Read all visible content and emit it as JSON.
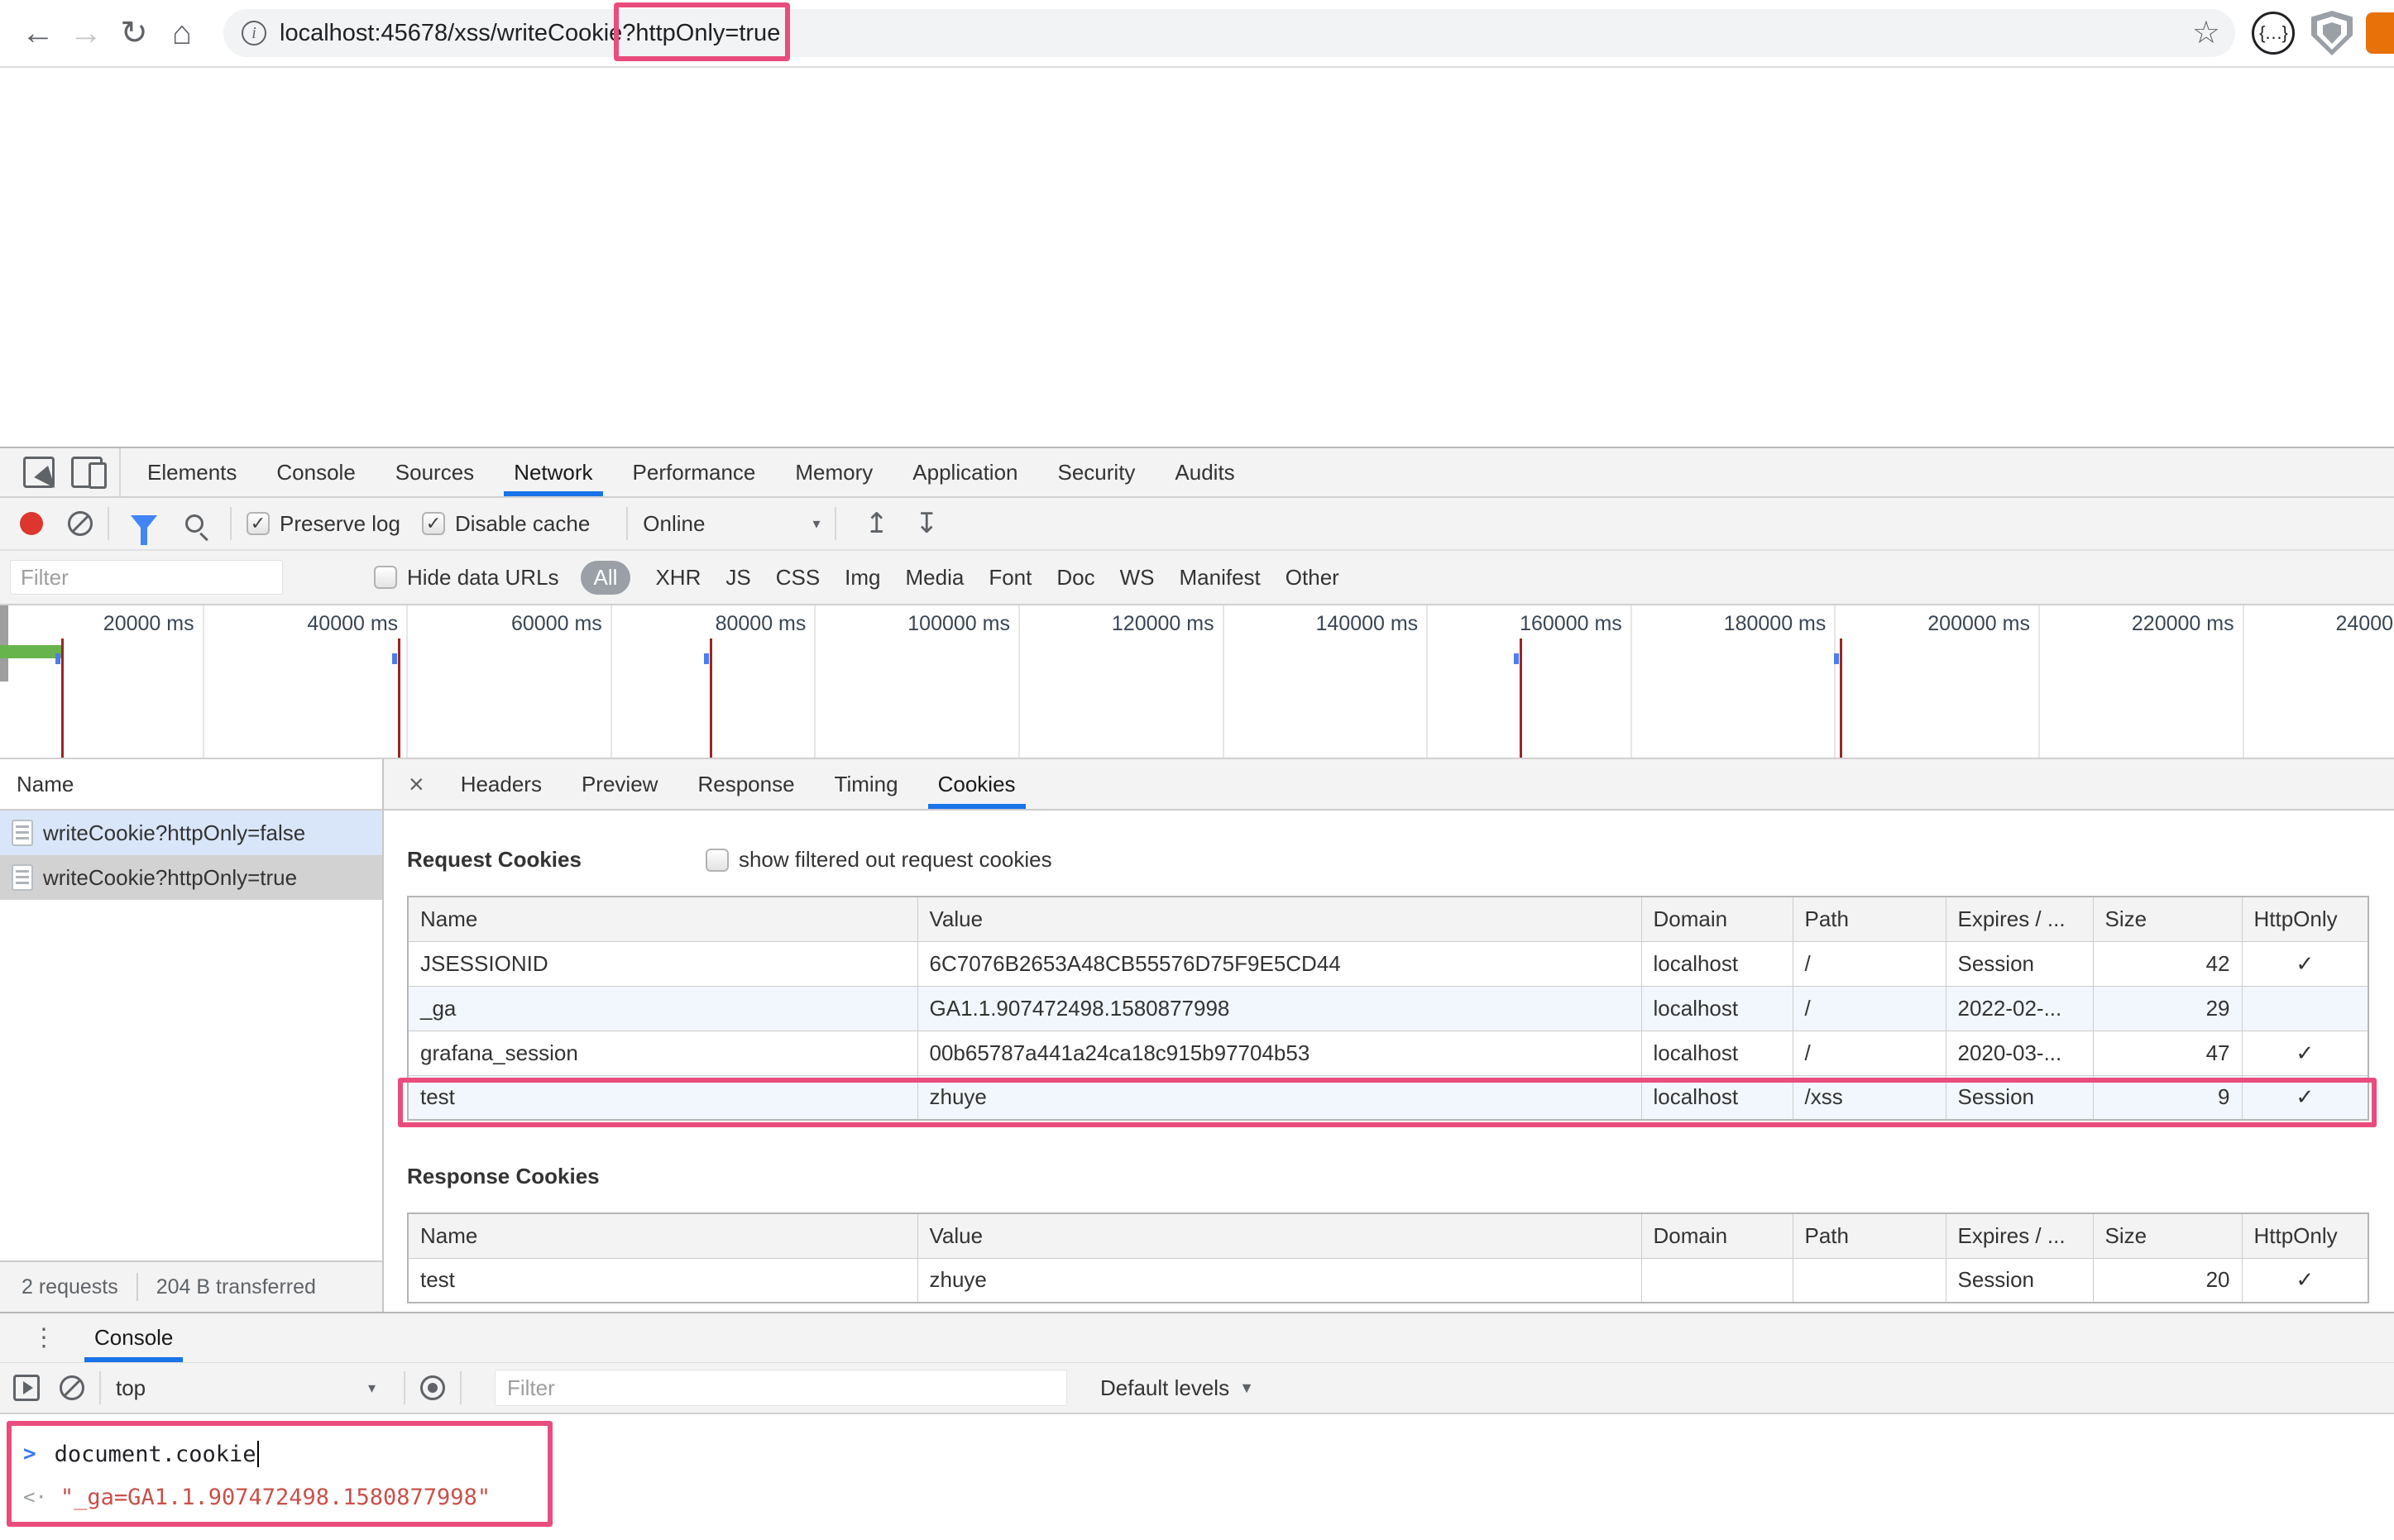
{
  "browser": {
    "url_prefix": "localhost:45678/xss/writeCookie",
    "url_highlight": "?httpOnly=true",
    "icons": {
      "back": "arrow-left",
      "forward": "arrow-right",
      "reload": "refresh",
      "home": "home",
      "page_info": "info-circle",
      "bookmark": "star-outline",
      "extension_braces": "curly-braces-circle",
      "extension_shield": "shield",
      "extension_partial": "orange-square"
    }
  },
  "devtools": {
    "main_tabs": [
      "Elements",
      "Console",
      "Sources",
      "Network",
      "Performance",
      "Memory",
      "Application",
      "Security",
      "Audits"
    ],
    "active_main_tab": "Network",
    "network_toolbar": {
      "preserve_log_label": "Preserve log",
      "preserve_log_checked": true,
      "disable_cache_label": "Disable cache",
      "disable_cache_checked": true,
      "throttling": "Online"
    },
    "filter_bar": {
      "placeholder": "Filter",
      "hide_data_urls_label": "Hide data URLs",
      "hide_data_urls_checked": false,
      "types": [
        "All",
        "XHR",
        "JS",
        "CSS",
        "Img",
        "Media",
        "Font",
        "Doc",
        "WS",
        "Manifest",
        "Other"
      ],
      "active_type": "All"
    },
    "timeline": {
      "tick_interval_ms": 20000,
      "tick_labels": [
        "20000 ms",
        "40000 ms",
        "60000 ms",
        "80000 ms",
        "100000 ms",
        "120000 ms",
        "140000 ms",
        "160000 ms",
        "180000 ms",
        "200000 ms",
        "220000 ms",
        "240000 ms"
      ],
      "load_events_ms": [
        6000,
        39000,
        69600,
        149000,
        180400
      ],
      "first_request_bar_ms": {
        "start": 0,
        "end": 6200
      }
    },
    "request_list": {
      "header": "Name",
      "rows": [
        {
          "name": "writeCookie?httpOnly=false",
          "state": "hl-blue"
        },
        {
          "name": "writeCookie?httpOnly=true",
          "state": "hl-gray"
        }
      ]
    },
    "detail_tabs": [
      "Headers",
      "Preview",
      "Response",
      "Timing",
      "Cookies"
    ],
    "active_detail_tab": "Cookies",
    "request_cookies": {
      "title": "Request Cookies",
      "checkbox_label": "show filtered out request cookies",
      "checkbox_checked": false,
      "columns": [
        "Name",
        "Value",
        "Domain",
        "Path",
        "Expires / ...",
        "Size",
        "HttpOnly"
      ],
      "rows": [
        {
          "name": "JSESSIONID",
          "value": "6C7076B2653A48CB55576D75F9E5CD44",
          "domain": "localhost",
          "path": "/",
          "expires": "Session",
          "size": "42",
          "httponly": "✓"
        },
        {
          "name": "_ga",
          "value": "GA1.1.907472498.1580877998",
          "domain": "localhost",
          "path": "/",
          "expires": "2022-02-...",
          "size": "29",
          "httponly": ""
        },
        {
          "name": "grafana_session",
          "value": "00b65787a441a24ca18c915b97704b53",
          "domain": "localhost",
          "path": "/",
          "expires": "2020-03-...",
          "size": "47",
          "httponly": "✓"
        },
        {
          "name": "test",
          "value": "zhuye",
          "domain": "localhost",
          "path": "/xss",
          "expires": "Session",
          "size": "9",
          "httponly": "✓"
        }
      ],
      "highlighted_row": "test"
    },
    "response_cookies": {
      "title": "Response Cookies",
      "columns": [
        "Name",
        "Value",
        "Domain",
        "Path",
        "Expires / ...",
        "Size",
        "HttpOnly"
      ],
      "rows": [
        {
          "name": "test",
          "value": "zhuye",
          "domain": "",
          "path": "",
          "expires": "Session",
          "size": "20",
          "httponly": "✓"
        }
      ],
      "highlighted_row": ""
    },
    "status_bar": {
      "requests": "2 requests",
      "transferred": "204 B transferred"
    }
  },
  "console": {
    "tab_label": "Console",
    "context": "top",
    "filter_placeholder": "Filter",
    "levels_label": "Default levels",
    "entries": [
      {
        "kind": "input",
        "text": "document.cookie"
      },
      {
        "kind": "result",
        "text": "\"_ga=GA1.1.907472498.1580877998\""
      }
    ]
  },
  "colors": {
    "annotation_pink": "#ea4c7d",
    "accent_blue": "#1a73e8",
    "result_red": "#c9504a",
    "timeline_event_red": "#9b2423",
    "timeline_bar_green": "#68b44c"
  }
}
